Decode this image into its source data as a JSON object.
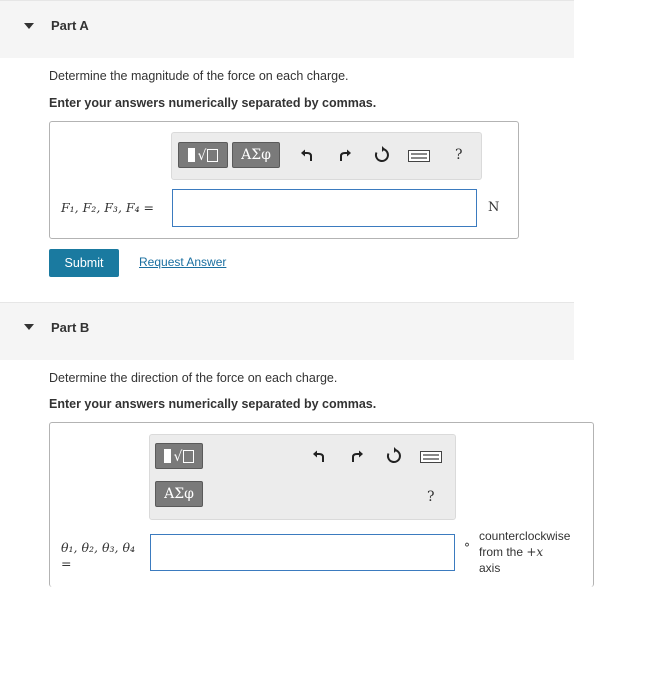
{
  "part_a": {
    "title": "Part A",
    "question": "Determine the magnitude of the force on each charge.",
    "instruction": "Enter your answers numerically separated by commas.",
    "toolbar": {
      "sqrt_label": "√",
      "greek_label": "ΑΣφ",
      "help_label": "?"
    },
    "variable_label": "F₁, F₂, F₃, F₄ =",
    "input_value": "",
    "unit": "N",
    "submit_label": "Submit",
    "request_label": "Request Answer"
  },
  "part_b": {
    "title": "Part B",
    "question": "Determine the direction of the force on each charge.",
    "instruction": "Enter your answers numerically separated by commas.",
    "toolbar": {
      "sqrt_label": "√",
      "greek_label": "ΑΣφ",
      "help_label": "?"
    },
    "variable_label": "θ₁, θ₂, θ₃, θ₄",
    "equals": "=",
    "input_value": "",
    "degree": "°",
    "unit_line1": "counterclockwise",
    "unit_line2_prefix": "from the ",
    "unit_line2_math": "+x",
    "unit_line3": "axis"
  },
  "colors": {
    "accent": "#1a7aa0",
    "input_border": "#3b7bbf",
    "header_bg": "#f5f5f5"
  }
}
